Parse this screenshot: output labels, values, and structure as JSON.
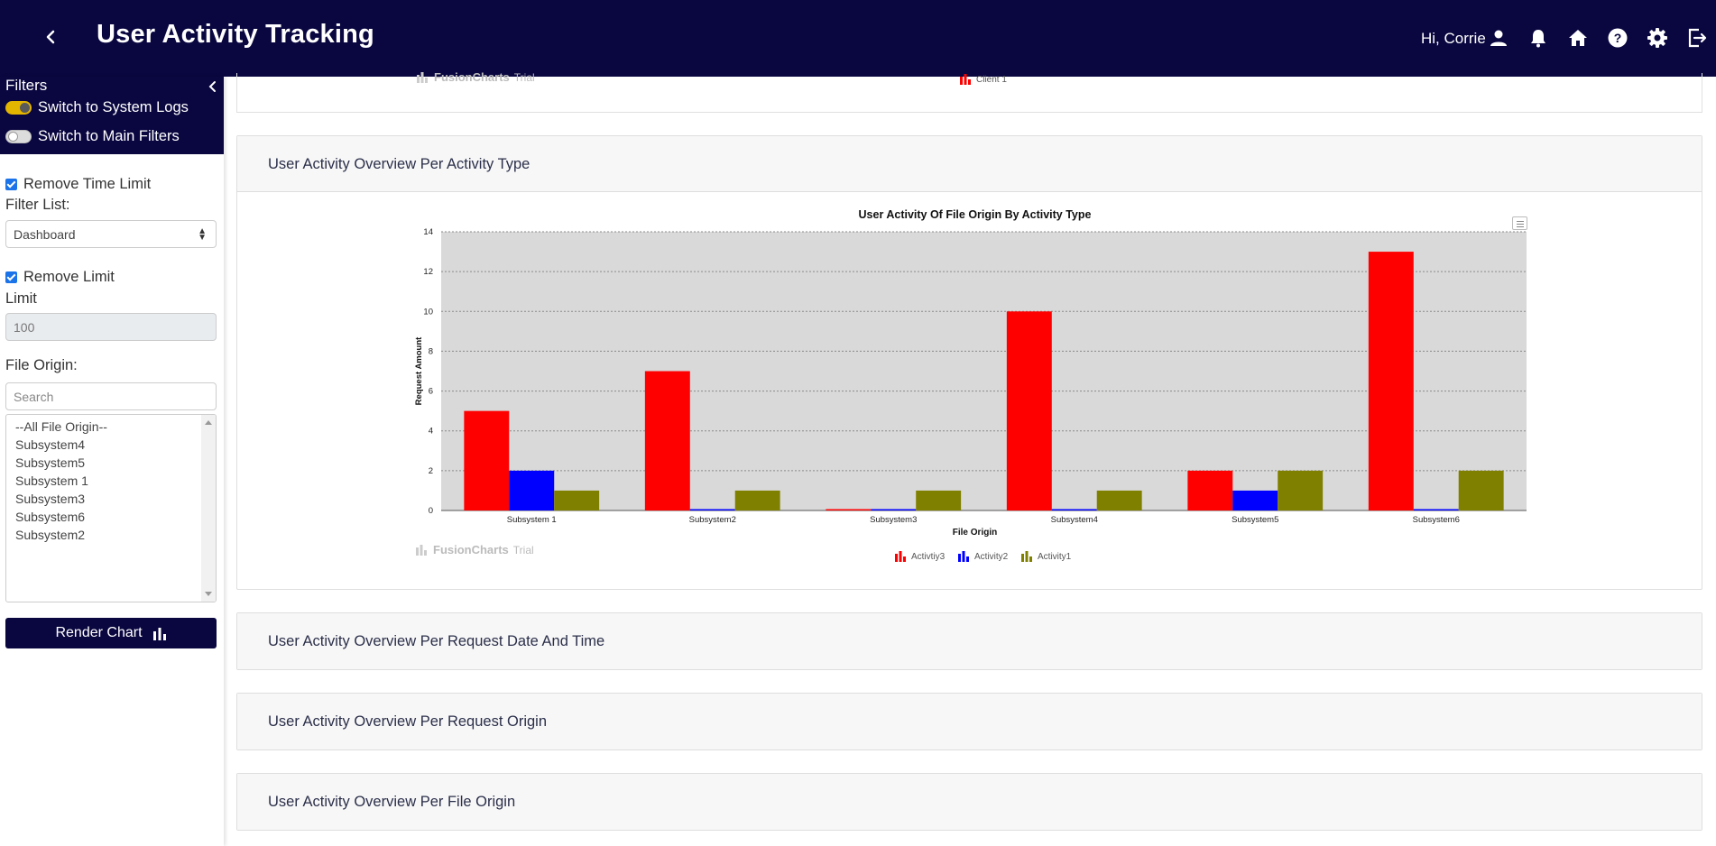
{
  "header": {
    "title": "User Activity Tracking",
    "greeting": "Hi, Corrie"
  },
  "sidebar": {
    "title": "Filters",
    "toggle_system_logs": "Switch to System Logs",
    "toggle_main_filters": "Switch to Main Filters",
    "remove_time_limit": "Remove Time Limit",
    "filter_list_label": "Filter List:",
    "filter_list_value": "Dashboard",
    "remove_limit": "Remove Limit",
    "limit_label": "Limit",
    "limit_value": "100",
    "file_origin_label": "File Origin:",
    "search_placeholder": "Search",
    "file_origins": [
      "--All File Origin--",
      "Subsystem4",
      "Subsystem5",
      "Subsystem 1",
      "Subsystem3",
      "Subsystem6",
      "Subsystem2"
    ],
    "render_button": "Render Chart"
  },
  "main": {
    "top_panel": {
      "watermark": "FusionCharts",
      "watermark_trial": "Trial",
      "legend": "Client 1"
    },
    "activity_card": {
      "title": "User Activity Overview Per Activity Type",
      "watermark": "FusionCharts",
      "watermark_trial": "Trial"
    },
    "collapsed_cards": [
      "User Activity Overview Per Request Date And Time",
      "User Activity Overview Per Request Origin",
      "User Activity Overview Per File Origin"
    ]
  },
  "colors": {
    "header_bg": "#0a0740",
    "toggle_on": "#e3b400"
  },
  "chart_data": {
    "type": "bar",
    "title": "User Activity Of File Origin By Activity Type",
    "xlabel": "File Origin",
    "ylabel": "Request Amount",
    "categories": [
      "Subsystem 1",
      "Subsystem2",
      "Subsystem3",
      "Subsystem4",
      "Subsystem5",
      "Subsystem6"
    ],
    "series": [
      {
        "name": "Activtiy3",
        "color": "#ff0000",
        "values": [
          5,
          7,
          0,
          10,
          2,
          13
        ]
      },
      {
        "name": "Activity2",
        "color": "#0000ff",
        "values": [
          2,
          0,
          0,
          0,
          1,
          0
        ]
      },
      {
        "name": "Activity1",
        "color": "#808000",
        "values": [
          1,
          1,
          1,
          1,
          2,
          2
        ]
      }
    ],
    "ylim": [
      0,
      14
    ],
    "yticks": [
      0,
      2,
      4,
      6,
      8,
      10,
      12,
      14
    ],
    "grid": true,
    "legend": "bottom"
  }
}
